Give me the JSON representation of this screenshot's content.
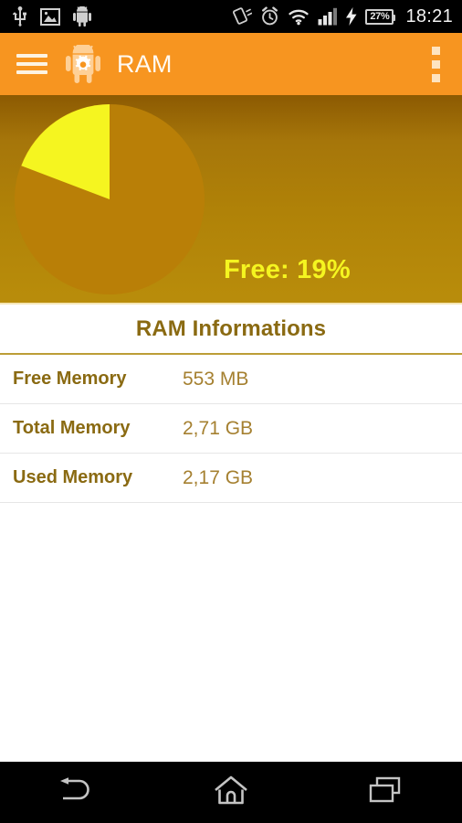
{
  "status_bar": {
    "left_icons": [
      "usb-icon",
      "image-icon",
      "android-icon"
    ],
    "right_icons": [
      "rotation-lock-icon",
      "alarm-clock-icon",
      "wifi-icon",
      "signal-bars-icon",
      "charging-bolt-icon"
    ],
    "battery_percent": "27%",
    "clock": "18:21",
    "background": "#000000"
  },
  "app_bar": {
    "menu_icon": "hamburger-menu-icon",
    "app_icon": "android-gear-icon",
    "title": "RAM",
    "overflow_icon": "overflow-menu-icon",
    "background": "#f79520",
    "title_color": "#fffaf2"
  },
  "chart_panel": {
    "free_label": "Free: 19%",
    "label_color": "#f5f520"
  },
  "chart_data": {
    "type": "pie",
    "title": "RAM usage",
    "categories": [
      "Free",
      "Used"
    ],
    "values": [
      19,
      81
    ],
    "unit": "%",
    "colors": [
      "#f5f520",
      "#b97f07"
    ],
    "start_angle": 0,
    "direction": "counterclockwise",
    "annotations": [
      "Free: 19%"
    ],
    "legend": "none",
    "grid": false
  },
  "info": {
    "section_title": "RAM Informations",
    "rows": [
      {
        "label": "Free Memory",
        "value": "553 MB"
      },
      {
        "label": "Total Memory",
        "value": "2,71 GB"
      },
      {
        "label": "Used Memory",
        "value": "2,17 GB"
      }
    ],
    "label_color": "#8a6a12",
    "value_color": "#a58030"
  },
  "nav_bar": {
    "back_icon": "back-arrow-icon",
    "home_icon": "home-icon",
    "recents_icon": "recent-apps-icon",
    "background": "#000000"
  }
}
